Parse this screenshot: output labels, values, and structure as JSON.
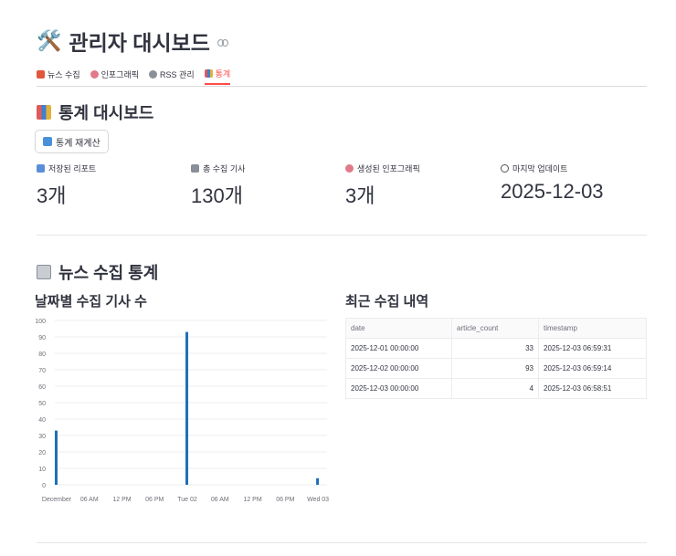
{
  "header": {
    "emoji": "🛠️",
    "title": "관리자 대시보드"
  },
  "tabs": [
    {
      "label": "뉴스 수집",
      "color": "#e0573c"
    },
    {
      "label": "인포그래픽",
      "color": "#e07a8a"
    },
    {
      "label": "RSS 관리",
      "color": "#8a8f99"
    },
    {
      "label": "통계",
      "color": "#3f7fd0",
      "active": true
    }
  ],
  "stats": {
    "title": "통계 대시보드",
    "recalc_button": "통계 재계산",
    "metrics": [
      {
        "label": "저장된 리포트",
        "value": "3개",
        "icon": "calendar-icon",
        "color": "#5a8fd8"
      },
      {
        "label": "총 수집 기사",
        "value": "130개",
        "icon": "newspaper-icon",
        "color": "#8a8f99"
      },
      {
        "label": "생성된 인포그래픽",
        "value": "3개",
        "icon": "art-icon",
        "color": "#e07a8a"
      },
      {
        "label": "마지막 업데이트",
        "value": "2025-12-03",
        "icon": "clock-icon",
        "color": "#555555"
      }
    ]
  },
  "news": {
    "title": "뉴스 수집 통계",
    "chart_title": "날짜별 수집 기사 수",
    "table_title": "최근 수집 내역"
  },
  "chart_data": {
    "type": "bar",
    "x": [
      "2025-12-01",
      "2025-12-02",
      "2025-12-03"
    ],
    "values": [
      33,
      93,
      4
    ],
    "ylim": [
      0,
      100
    ],
    "yticks": [
      0,
      10,
      20,
      30,
      40,
      50,
      60,
      70,
      80,
      90,
      100
    ],
    "xtick_labels": [
      "December",
      "06 AM",
      "12 PM",
      "06 PM",
      "Tue 02",
      "06 AM",
      "12 PM",
      "06 PM",
      "Wed 03"
    ],
    "color": "#1f6fb9",
    "grid": true
  },
  "table": {
    "columns": [
      "date",
      "article_count",
      "timestamp"
    ],
    "rows": [
      [
        "2025-12-01 00:00:00",
        "33",
        "2025-12-03 06:59:31"
      ],
      [
        "2025-12-02 00:00:00",
        "93",
        "2025-12-03 06:59:14"
      ],
      [
        "2025-12-03 00:00:00",
        "4",
        "2025-12-03 06:58:51"
      ]
    ]
  }
}
